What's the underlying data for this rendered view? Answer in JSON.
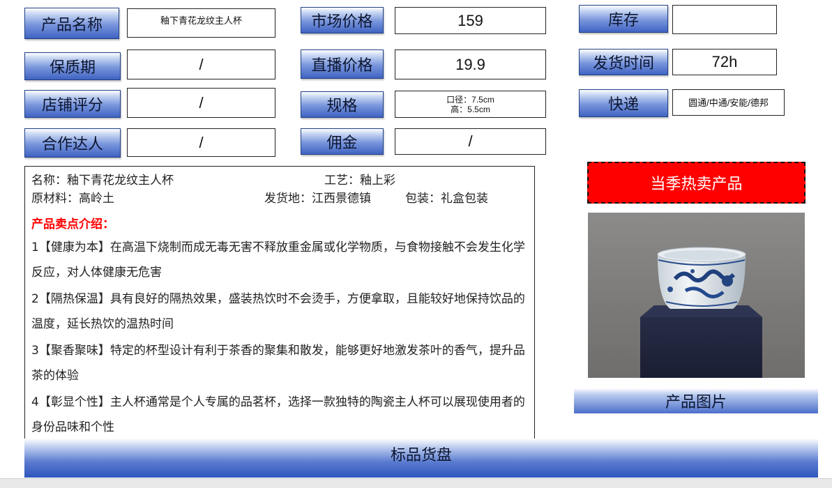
{
  "grid": {
    "product_name_label": "产品名称",
    "product_name_value": "釉下青花龙纹主人杯",
    "market_price_label": "市场价格",
    "market_price_value": "159",
    "stock_label": "库存",
    "stock_value": "",
    "shelf_life_label": "保质期",
    "shelf_life_value": "/",
    "live_price_label": "直播价格",
    "live_price_value": "19.9",
    "ship_time_label": "发货时间",
    "ship_time_value": "72h",
    "shop_score_label": "店铺评分",
    "shop_score_value": "/",
    "spec_label": "规格",
    "spec_line1": "口径：7.5cm",
    "spec_line2": "高：5.5cm",
    "express_label": "快递",
    "express_value": "圆通/中通/安能/德邦",
    "partner_label": "合作达人",
    "partner_value": "/",
    "commission_label": "佣金",
    "commission_value": "/"
  },
  "description": {
    "name": "名称：釉下青花龙纹主人杯",
    "craft": "工艺：釉上彩",
    "material": "原材料：高岭土",
    "origin": "发货地：江西景德镇",
    "package": "包装：礼盒包装",
    "selling_title": "产品卖点介绍：",
    "points": [
      "1【健康为本】在高温下烧制而成无毒无害不释放重金属或化学物质，与食物接触不会发生化学反应，对人体健康无危害",
      "2【隔热保温】具有良好的隔热效果，盛装热饮时不会烫手，方便拿取，且能较好地保持饮品的温度，延长热饮的温热时间",
      "3【聚香聚味】特定的杯型设计有利于茶香的聚集和散发，能够更好地激发茶叶的香气，提升品茶的体验",
      "4【彰显个性】主人杯通常是个人专属的品茗杯，选择一款独特的陶瓷主人杯可以展现使用者的身份品味和个性"
    ]
  },
  "hot_badge": "当季热卖产品",
  "photo_caption": "产品图片",
  "footer_title": "标品货盘",
  "colors": {
    "label_blue": "#3f63c2",
    "hot_red": "#ff0000",
    "sell_title_red": "#ff0000"
  }
}
